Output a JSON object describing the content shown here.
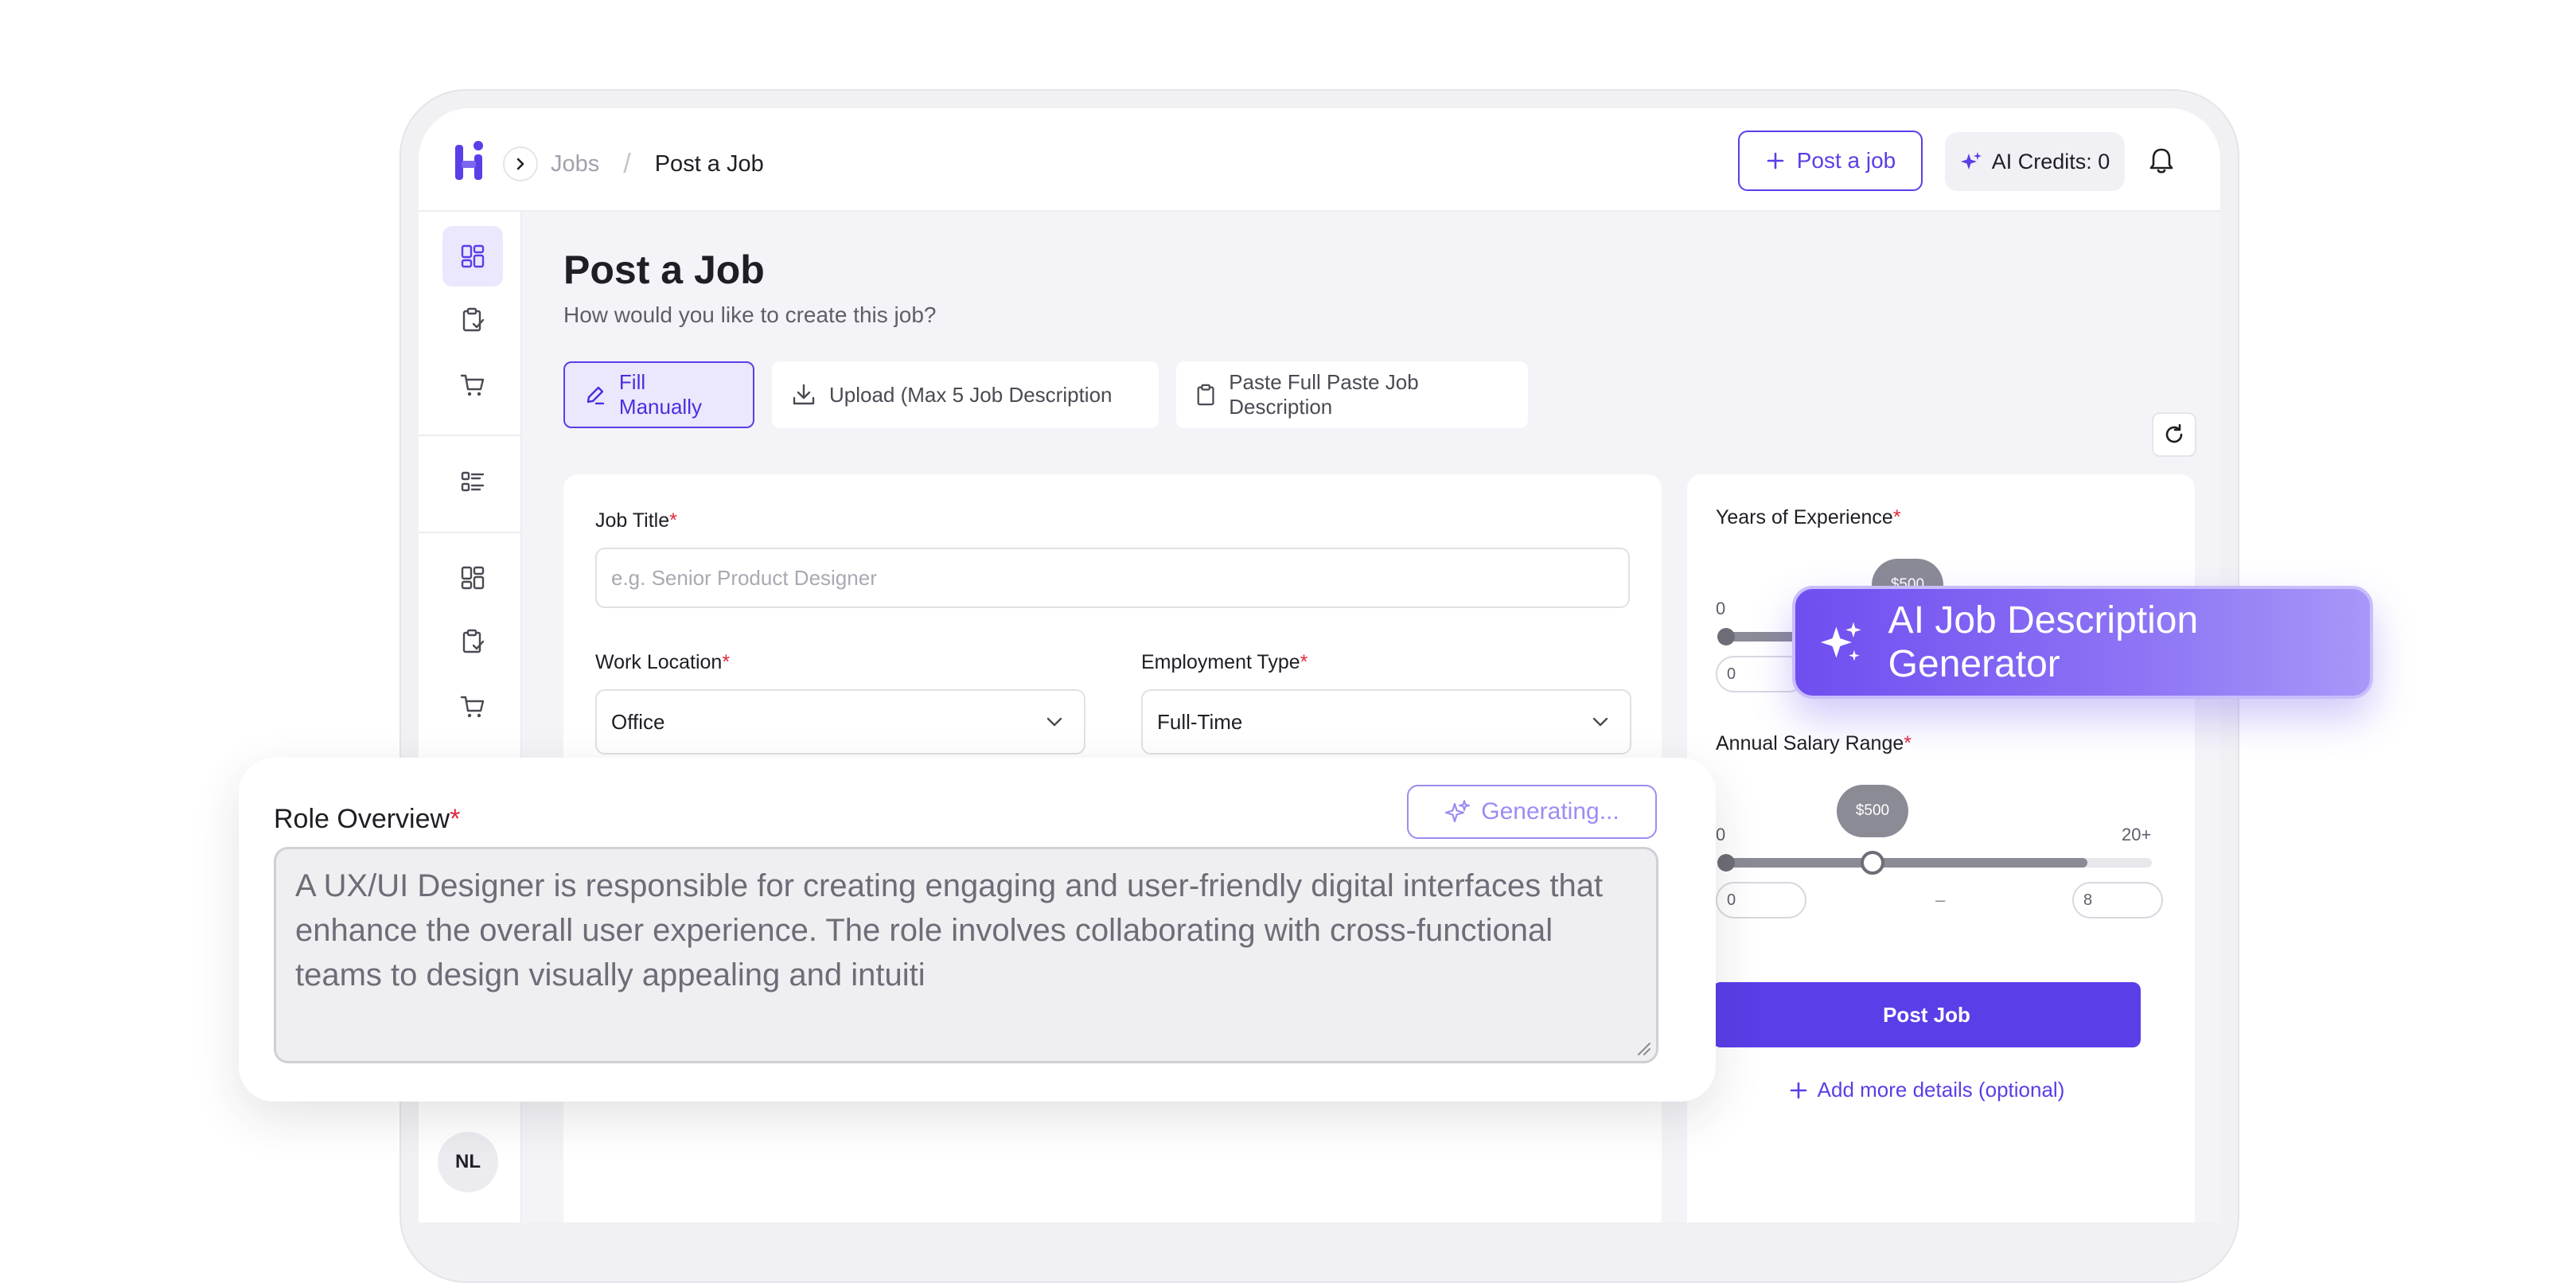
{
  "header": {
    "breadcrumb_root": "Jobs",
    "breadcrumb_sep": "/",
    "breadcrumb_current": "Post a Job",
    "post_job_button": "Post a job",
    "ai_credits": "AI Credits: 0"
  },
  "sidebar": {
    "avatar_initials": "NL",
    "icons": [
      "dashboard-icon",
      "clipboard-check-icon",
      "cart-icon",
      "list-icon",
      "dashboard-icon",
      "clipboard-check-icon",
      "cart-icon"
    ]
  },
  "page": {
    "title": "Post a Job",
    "subtitle": "How would you like to create this job?",
    "modes": {
      "fill_manually": "Fill Manually",
      "upload": "Upload (Max 5 Job Description",
      "paste": "Paste Full Paste Job Description"
    }
  },
  "form": {
    "job_title_label": "Job Title",
    "job_title_placeholder": "e.g. Senior Product Designer",
    "work_location_label": "Work Location",
    "work_location_value": "Office",
    "employment_type_label": "Employment Type",
    "employment_type_value": "Full-Time",
    "required_mark": "*"
  },
  "experience": {
    "label": "Years of Experience",
    "min_label": "0",
    "bubble": "$500",
    "min_value": "0"
  },
  "salary": {
    "label": "Annual Salary Range",
    "min_label": "0",
    "max_label": "20+",
    "bubble": "$500",
    "min_value": "0",
    "max_value": "8",
    "range_dash": "–",
    "min_fraction": 0.0,
    "thumb_fraction": 0.35,
    "fill_end_fraction": 0.85
  },
  "actions": {
    "post_job": "Post Job",
    "add_more": "Add more details (optional)"
  },
  "role_overview": {
    "label": "Role Overview",
    "generating": "Generating...",
    "text": "A UX/UI Designer is responsible for creating engaging and user-friendly digital interfaces that enhance the overall user experience. The role involves collaborating with cross-functional teams to design visually appealing and intuiti"
  },
  "ai_badge": {
    "label": "AI Job Description Generator"
  },
  "colors": {
    "accent": "#5a3ee8",
    "required": "#e0293d",
    "badge_start": "#6f4ef0",
    "badge_end": "#a997f8"
  }
}
